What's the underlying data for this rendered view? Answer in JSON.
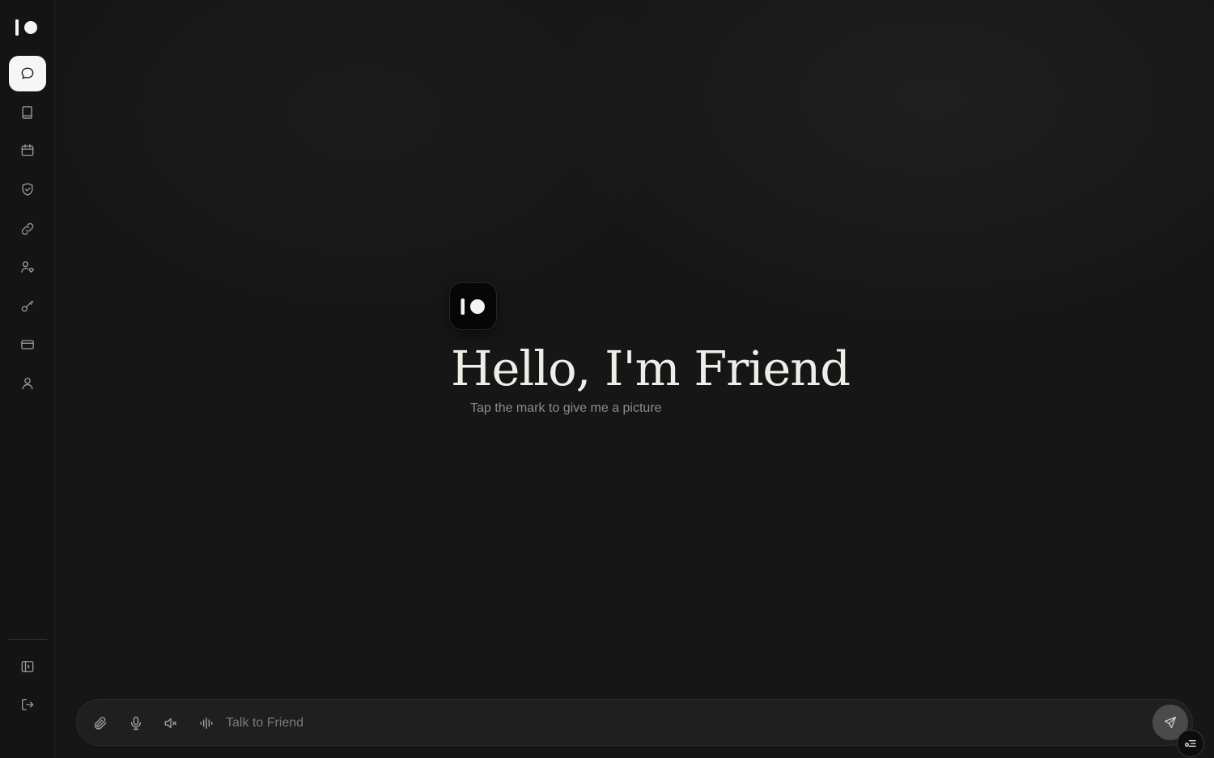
{
  "app": {
    "name": "Friend"
  },
  "sidebar": {
    "items": [
      {
        "icon": "chat-bubble-icon",
        "active": true
      },
      {
        "icon": "book-icon",
        "active": false
      },
      {
        "icon": "calendar-icon",
        "active": false
      },
      {
        "icon": "shield-check-icon",
        "active": false
      },
      {
        "icon": "link-icon",
        "active": false
      },
      {
        "icon": "user-heart-icon",
        "active": false
      },
      {
        "icon": "key-icon",
        "active": false
      },
      {
        "icon": "credit-card-icon",
        "active": false
      },
      {
        "icon": "user-icon",
        "active": false
      }
    ],
    "footer_items": [
      {
        "icon": "sidebar-toggle-icon"
      },
      {
        "icon": "logout-icon"
      }
    ]
  },
  "hero": {
    "title": "Hello, I'm Friend",
    "subtitle": "Tap the mark to give me a picture"
  },
  "composer": {
    "placeholder": "Talk to Friend",
    "value": "",
    "tools": [
      "paperclip-icon",
      "microphone-icon",
      "speaker-muted-icon",
      "audio-waveform-icon"
    ],
    "send_icon": "send-icon"
  },
  "floating_badge": {
    "icon": "settings-list-icon"
  },
  "colors": {
    "background": "#161616",
    "sidebar": "#141414",
    "active_nav": "#f6f6f4",
    "title_text": "#efede8",
    "muted_text": "#8d8d8d"
  }
}
